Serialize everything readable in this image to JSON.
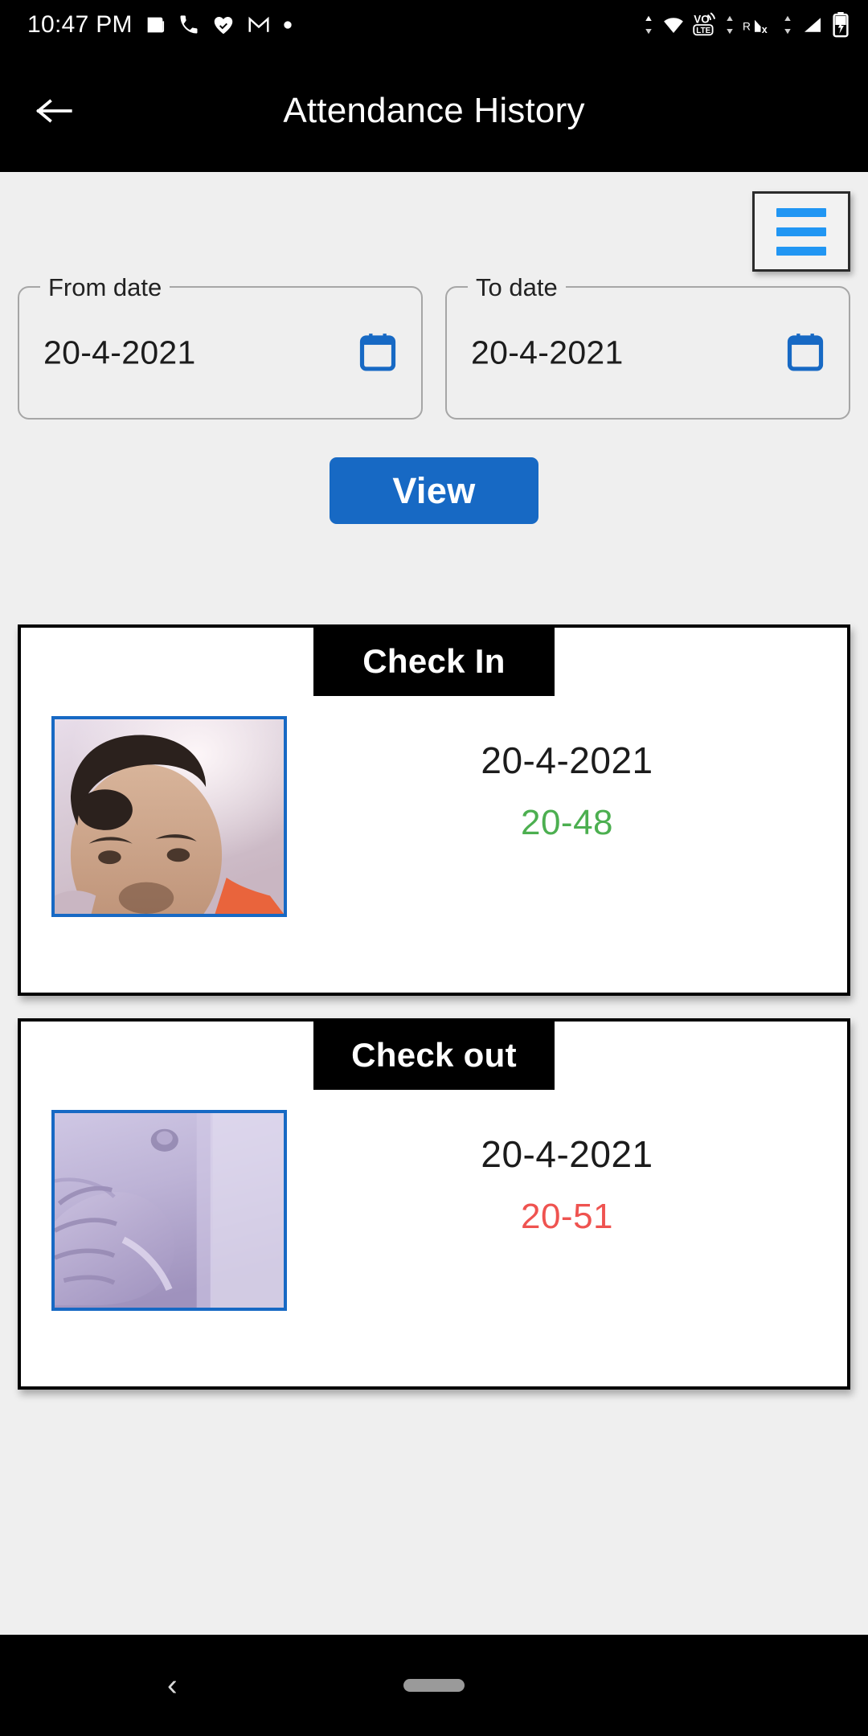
{
  "status_bar": {
    "time": "10:47 PM",
    "left_icons": [
      "news-icon",
      "phone-icon",
      "heart-health-icon",
      "gmail-icon",
      "dot-icon"
    ],
    "right_icons": [
      "data-transfer-icon",
      "wifi-icon",
      "volte-icon",
      "data-transfer-icon",
      "roaming-signal-off-icon",
      "data-transfer-icon",
      "signal-icon",
      "battery-charging-icon"
    ]
  },
  "app_bar": {
    "back_icon": "arrow-left-icon",
    "title": "Attendance History"
  },
  "toolbar": {
    "menu_icon": "hamburger-menu-icon",
    "accent_color": "#2196f3"
  },
  "filters": {
    "from": {
      "label": "From date",
      "value": "20-4-2021",
      "icon": "calendar-icon"
    },
    "to": {
      "label": "To date",
      "value": "20-4-2021",
      "icon": "calendar-icon"
    },
    "view_button": "View",
    "button_color": "#1769c4"
  },
  "records": [
    {
      "type": "Check In",
      "date": "20-4-2021",
      "time": "20-48",
      "time_color": "#4caf50",
      "photo_alt": "selfie-photo"
    },
    {
      "type": "Check out",
      "date": "20-4-2021",
      "time": "20-51",
      "time_color": "#ef5350",
      "photo_alt": "hand-photo"
    }
  ],
  "nav_bar": {
    "back_icon": "nav-back-icon",
    "home_pill": "home-pill-icon"
  }
}
